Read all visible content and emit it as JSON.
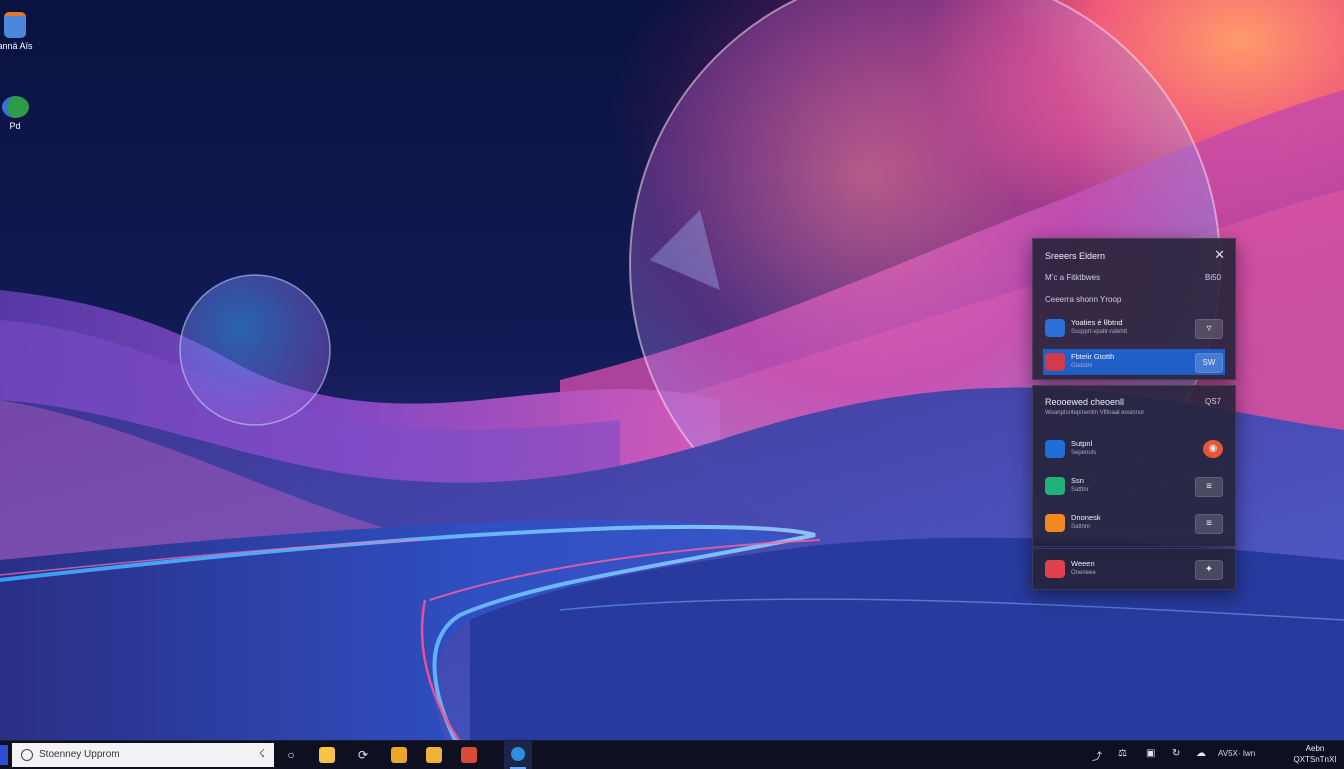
{
  "desktop": {
    "icons": [
      {
        "label": "annä Aïs",
        "color": "#4a86d9"
      },
      {
        "label": "Pd",
        "color": "#2d9c4a"
      }
    ]
  },
  "flyout": {
    "title": "Sreeers Eldern",
    "close_glyph": "✕",
    "info_label": "M’c a Fitktbwes",
    "info_value": "Bi50",
    "section_label": "Ceeerra shonn Yroop",
    "top_items": [
      {
        "name": "Yoaties é θbtnd",
        "sub": "Sscpprt-vpaltr-ratehtt",
        "icon_color": "#2a6fd6",
        "action": "▿"
      },
      {
        "name": "Fbteiir Gtotth",
        "sub": "Gtattahi",
        "icon_color": "#d23b4f",
        "action": "SW",
        "selected": true
      }
    ],
    "section2_title": "Reooewed cheoenll",
    "section2_value": "QS7",
    "section2_sub": "Woanptsntepinentin Vfitnaal eosinnor",
    "apps": [
      {
        "name": "Sutpnl",
        "sub": "Sepenuts",
        "icon_color": "#1f6fd9",
        "action": "◉"
      },
      {
        "name": "Ssn",
        "sub": "Satttnr",
        "icon_color": "#22b07a",
        "action": "≡"
      },
      {
        "name": "Dnonesk",
        "sub": "Sattnnr",
        "icon_color": "#f08a1c",
        "action": "≡"
      }
    ],
    "bottom_item": {
      "name": "Weeen",
      "sub": "Oneneee",
      "icon_color": "#e0414e",
      "action": "✦"
    }
  },
  "taskbar": {
    "search_text": "Stoenney Upprom",
    "mic_glyph": "☇",
    "task_view_glyph": "○",
    "refresh_glyph": "⟳",
    "apps": [
      {
        "name": "file-explorer",
        "color": "#f5c542"
      },
      {
        "name": "store",
        "color": "#e9a82a"
      },
      {
        "name": "photos",
        "color": "#f0b33a"
      },
      {
        "name": "calendar",
        "color": "#d94a3a"
      }
    ],
    "active_app_color": "#2b8fe0",
    "tray": {
      "chevron": "⤴",
      "icons": [
        "⚖",
        "▣",
        "↻",
        "☁"
      ],
      "lang": "AV5X· Iwn",
      "clock_time": "Aebn",
      "clock_date": "QXTSnTnXI"
    }
  }
}
